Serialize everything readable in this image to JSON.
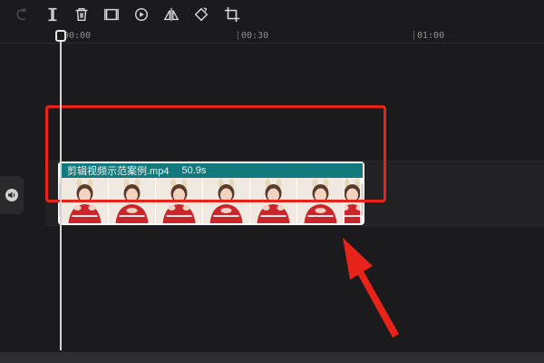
{
  "toolbar": {
    "tools": [
      {
        "icon": "undo-icon"
      },
      {
        "icon": "split-icon"
      },
      {
        "icon": "delete-icon"
      },
      {
        "icon": "freeze-frame-icon"
      },
      {
        "icon": "play-reverse-icon"
      },
      {
        "icon": "mirror-icon"
      },
      {
        "icon": "rotate-icon"
      },
      {
        "icon": "crop-icon"
      }
    ]
  },
  "ruler": {
    "ticks": [
      "00:00",
      "00:30",
      "01:00"
    ]
  },
  "clip": {
    "name": "剪辑视频示范案例.mp4",
    "duration": "50.9s",
    "frame_count": 7
  },
  "colors": {
    "background": "#1b1b1d",
    "clip_header": "#127a7c",
    "highlight": "#e8231a"
  }
}
